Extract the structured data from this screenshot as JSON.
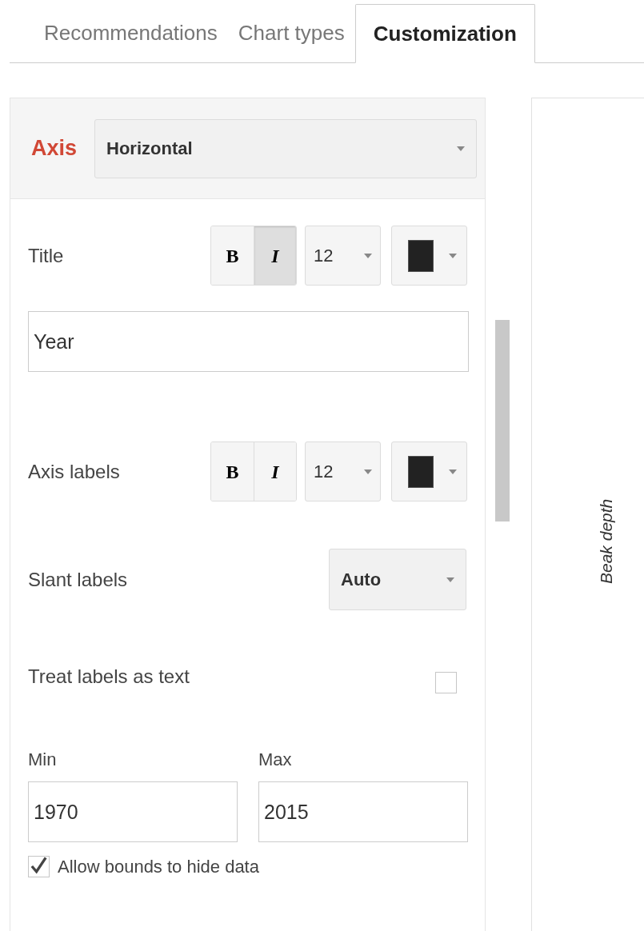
{
  "tabs": [
    {
      "label": "Recommendations",
      "selected": false
    },
    {
      "label": "Chart types",
      "selected": false
    },
    {
      "label": "Customization",
      "selected": true
    }
  ],
  "axis": {
    "label": "Axis",
    "value": "Horizontal"
  },
  "format_rows": [
    {
      "label": "Title",
      "bold": {
        "text": "B",
        "on": false
      },
      "italic": {
        "text": "I",
        "on": true
      },
      "size": "12",
      "color": "#222222"
    },
    {
      "label": "Axis labels",
      "bold": {
        "text": "B",
        "on": false
      },
      "italic": {
        "text": "I",
        "on": false
      },
      "size": "12",
      "color": "#222222"
    }
  ],
  "title_field": {
    "value": "Year"
  },
  "slant_labels": {
    "label": "Slant labels",
    "value": "Auto"
  },
  "treat_labels_as_text": {
    "label": "Treat labels as text",
    "checked": false
  },
  "min": {
    "label": "Min",
    "value": "1970"
  },
  "max": {
    "label": "Max",
    "value": "2015"
  },
  "allow_bounds": {
    "label": "Allow bounds to hide data",
    "checked": true
  },
  "preview": {
    "axis_title": "Beak depth"
  }
}
